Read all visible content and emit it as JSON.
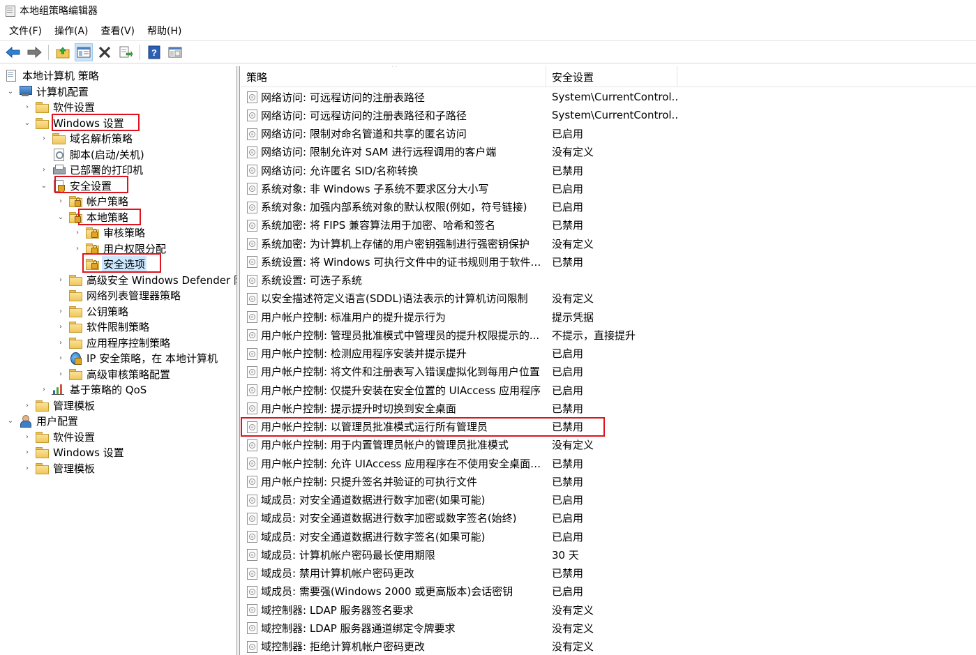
{
  "window": {
    "title": "本地组策略编辑器",
    "icon": "gpedit-icon"
  },
  "menu": [
    "文件(F)",
    "操作(A)",
    "查看(V)",
    "帮助(H)"
  ],
  "toolbar": {
    "buttons": [
      "back-icon",
      "forward-icon",
      "up-folder-icon",
      "show-hide-tree-icon",
      "delete-icon",
      "export-list-icon",
      "help-icon",
      "properties-view-icon"
    ]
  },
  "tree": {
    "root": "本地计算机 策略",
    "computer_config": "计算机配置",
    "cc_software": "软件设置",
    "cc_windows": "Windows 设置",
    "dns_policy": "域名解析策略",
    "scripts": "脚本(启动/关机)",
    "printers": "已部署的打印机",
    "security_settings": "安全设置",
    "account_policy": "帐户策略",
    "local_policy": "本地策略",
    "audit_policy": "审核策略",
    "user_rights": "用户权限分配",
    "security_options": "安全选项",
    "defender_firewall": "高级安全 Windows Defender 防",
    "network_list": "网络列表管理器策略",
    "public_key": "公钥策略",
    "software_restriction": "软件限制策略",
    "app_control": "应用程序控制策略",
    "ip_security": "IP 安全策略，在 本地计算机",
    "adv_audit": "高级审核策略配置",
    "qos": "基于策略的 QoS",
    "cc_admin_templates": "管理模板",
    "user_config": "用户配置",
    "uc_software": "软件设置",
    "uc_windows": "Windows 设置",
    "uc_admin_templates": "管理模板"
  },
  "list": {
    "col_policy": "策略",
    "col_setting": "安全设置",
    "rows": [
      {
        "policy": "网络访问: 可远程访问的注册表路径",
        "setting": "System\\CurrentControl..."
      },
      {
        "policy": "网络访问: 可远程访问的注册表路径和子路径",
        "setting": "System\\CurrentControl..."
      },
      {
        "policy": "网络访问: 限制对命名管道和共享的匿名访问",
        "setting": "已启用"
      },
      {
        "policy": "网络访问: 限制允许对 SAM 进行远程调用的客户端",
        "setting": "没有定义"
      },
      {
        "policy": "网络访问: 允许匿名 SID/名称转换",
        "setting": "已禁用"
      },
      {
        "policy": "系统对象: 非 Windows 子系统不要求区分大小写",
        "setting": "已启用"
      },
      {
        "policy": "系统对象: 加强内部系统对象的默认权限(例如，符号链接)",
        "setting": "已启用"
      },
      {
        "policy": "系统加密: 将 FIPS 兼容算法用于加密、哈希和签名",
        "setting": "已禁用"
      },
      {
        "policy": "系统加密: 为计算机上存储的用户密钥强制进行强密钥保护",
        "setting": "没有定义"
      },
      {
        "policy": "系统设置: 将 Windows 可执行文件中的证书规则用于软件限...",
        "setting": "已禁用"
      },
      {
        "policy": "系统设置: 可选子系统",
        "setting": ""
      },
      {
        "policy": "以安全描述符定义语言(SDDL)语法表示的计算机访问限制",
        "setting": "没有定义"
      },
      {
        "policy": "用户帐户控制: 标准用户的提升提示行为",
        "setting": "提示凭据"
      },
      {
        "policy": "用户帐户控制: 管理员批准模式中管理员的提升权限提示的...",
        "setting": "不提示，直接提升"
      },
      {
        "policy": "用户帐户控制: 检测应用程序安装并提示提升",
        "setting": "已启用"
      },
      {
        "policy": "用户帐户控制: 将文件和注册表写入错误虚拟化到每用户位置",
        "setting": "已启用"
      },
      {
        "policy": "用户帐户控制: 仅提升安装在安全位置的 UIAccess 应用程序",
        "setting": "已启用"
      },
      {
        "policy": "用户帐户控制: 提示提升时切换到安全桌面",
        "setting": "已禁用"
      },
      {
        "policy": "用户帐户控制: 以管理员批准模式运行所有管理员",
        "setting": "已禁用"
      },
      {
        "policy": "用户帐户控制: 用于内置管理员帐户的管理员批准模式",
        "setting": "没有定义"
      },
      {
        "policy": "用户帐户控制: 允许 UIAccess 应用程序在不使用安全桌面的...",
        "setting": "已禁用"
      },
      {
        "policy": "用户帐户控制: 只提升签名并验证的可执行文件",
        "setting": "已禁用"
      },
      {
        "policy": "域成员: 对安全通道数据进行数字加密(如果可能)",
        "setting": "已启用"
      },
      {
        "policy": "域成员: 对安全通道数据进行数字加密或数字签名(始终)",
        "setting": "已启用"
      },
      {
        "policy": "域成员: 对安全通道数据进行数字签名(如果可能)",
        "setting": "已启用"
      },
      {
        "policy": "域成员: 计算机帐户密码最长使用期限",
        "setting": "30 天"
      },
      {
        "policy": "域成员: 禁用计算机帐户密码更改",
        "setting": "已禁用"
      },
      {
        "policy": "域成员: 需要强(Windows 2000 或更高版本)会话密钥",
        "setting": "已启用"
      },
      {
        "policy": "域控制器: LDAP 服务器签名要求",
        "setting": "没有定义"
      },
      {
        "policy": "域控制器: LDAP 服务器通道绑定令牌要求",
        "setting": "没有定义"
      },
      {
        "policy": "域控制器: 拒绝计算机帐户密码更改",
        "setting": "没有定义"
      }
    ]
  },
  "colors": {
    "highlight_border": "#e0121d",
    "selection": "#cce8ff"
  }
}
